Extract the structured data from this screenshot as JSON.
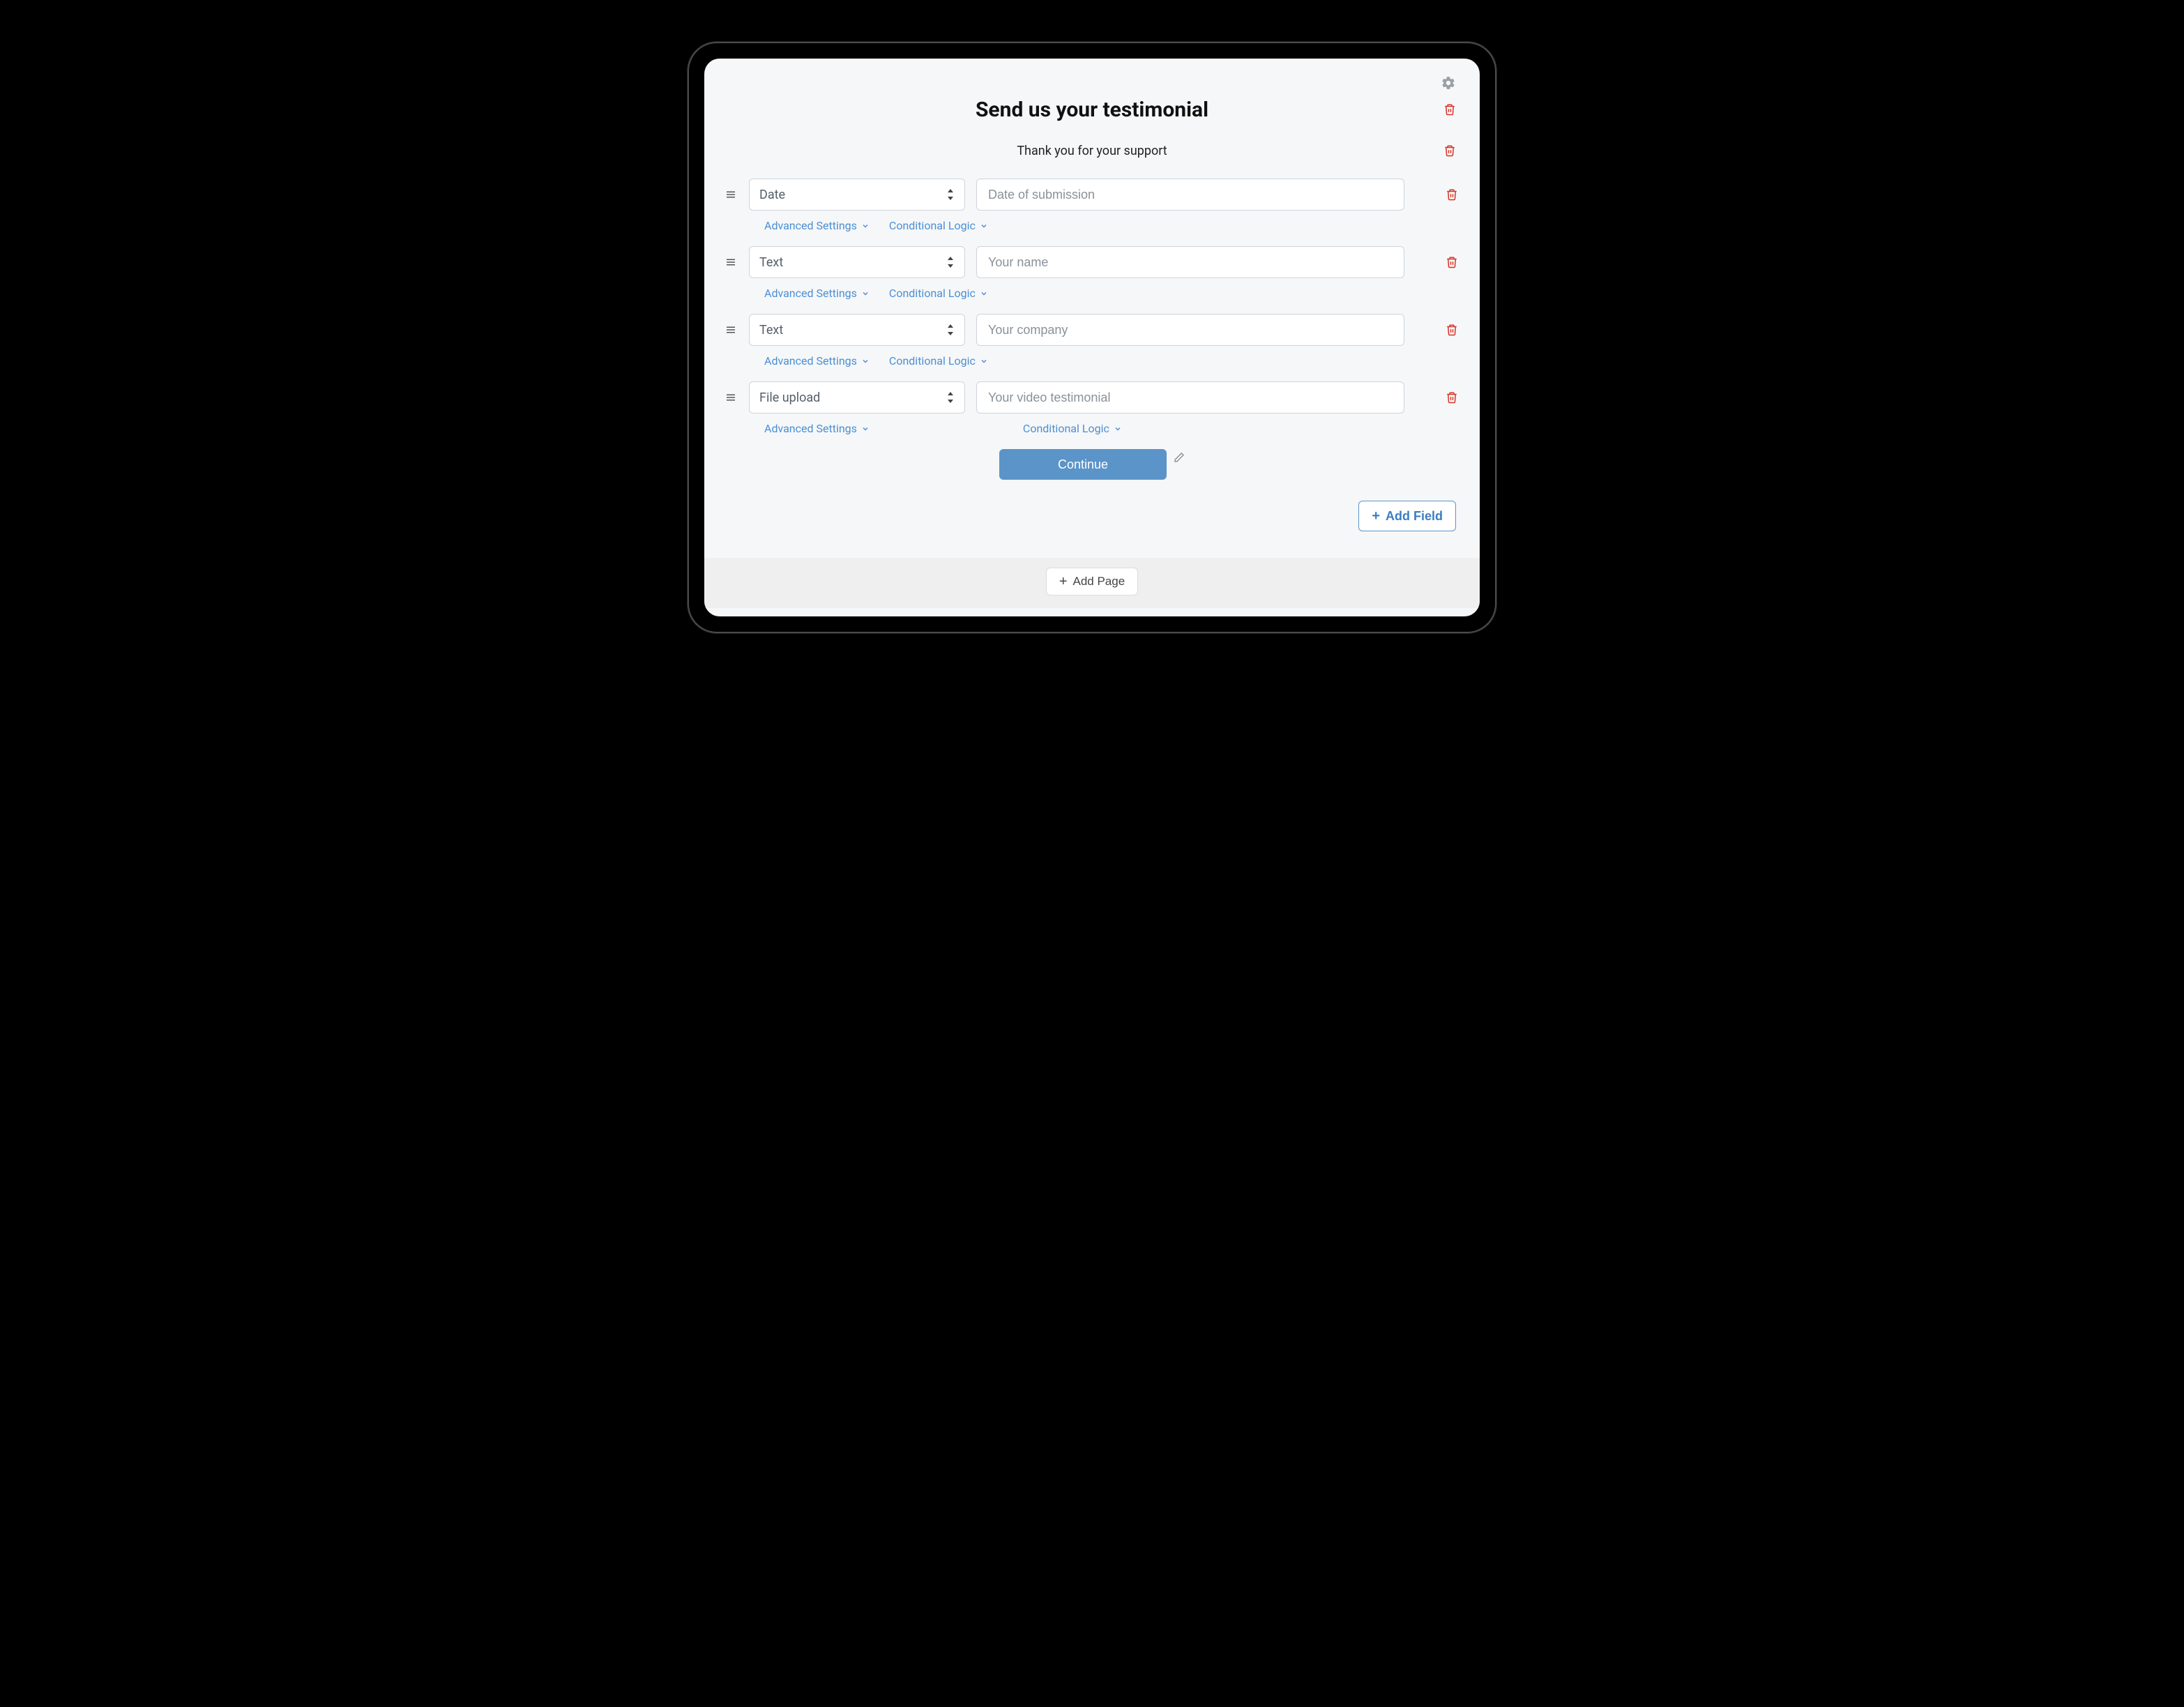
{
  "header": {
    "title": "Send us your testimonial",
    "subtitle": "Thank you for your support"
  },
  "fields": [
    {
      "type": "Date",
      "placeholder": "Date of submission",
      "advanced": "Advanced Settings",
      "conditional": "Conditional Logic",
      "wide_settings": false
    },
    {
      "type": "Text",
      "placeholder": "Your name",
      "advanced": "Advanced Settings",
      "conditional": "Conditional Logic",
      "wide_settings": false
    },
    {
      "type": "Text",
      "placeholder": "Your company",
      "advanced": "Advanced Settings",
      "conditional": "Conditional Logic",
      "wide_settings": false
    },
    {
      "type": "File upload",
      "placeholder": "Your video testimonial",
      "advanced": "Advanced Settings",
      "conditional": "Conditional Logic",
      "wide_settings": true
    }
  ],
  "actions": {
    "continue": "Continue",
    "add_field": "Add Field",
    "add_page": "Add Page"
  }
}
